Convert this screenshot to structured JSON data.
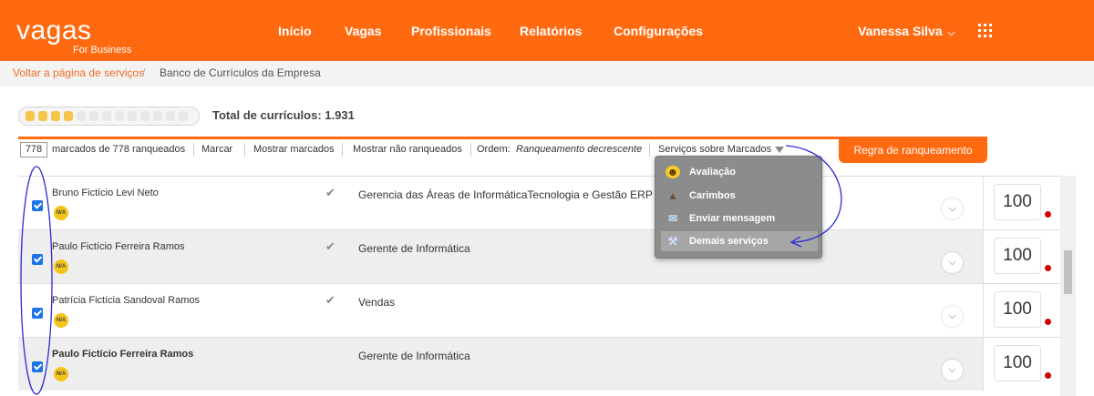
{
  "header": {
    "logo_word": "vagas",
    "logo_sub": "For Business",
    "nav": [
      "Início",
      "Vagas",
      "Profissionais",
      "Relatórios",
      "Configurações"
    ],
    "user_name": "Vanessa Silva",
    "apps_icon": "grid-icon"
  },
  "breadcrumb": {
    "back_link": "Voltar a página de serviços",
    "separator": "/",
    "current": "Banco de Currículos da Empresa"
  },
  "summary": {
    "total_label": "Total de currículos: 1.931"
  },
  "toolbar": {
    "marked_count": "778",
    "marked_text": "marcados de 778 ranqueados",
    "mark": "Marcar",
    "show_marked": "Mostrar marcados",
    "show_unranked": "Mostrar não ranqueados",
    "order_label": "Ordem:",
    "order_value": "Ranqueamento decrescente",
    "services_menu": "Serviços sobre Marcados",
    "ranking_rule_button": "Regra de ranqueamento"
  },
  "dropdown": {
    "items": [
      {
        "label": "Avaliação",
        "icon": "smiley-icon"
      },
      {
        "label": "Carimbos",
        "icon": "stamp-icon"
      },
      {
        "label": "Enviar mensagem",
        "icon": "envelope-icon"
      },
      {
        "label": "Demais serviços",
        "icon": "wrench-icon"
      }
    ],
    "highlighted_index": 3
  },
  "rows": [
    {
      "name": "Bruno Fictício Levi Neto",
      "badge": "N/A",
      "role": "Gerencia das Áreas de InformáticaTecnologia e Gestão ERP",
      "score": "100",
      "checked": true,
      "viewed": true
    },
    {
      "name": "Paulo Fictício Ferreira Ramos",
      "badge": "N/A",
      "role": "Gerente de Informática",
      "score": "100",
      "checked": true,
      "viewed": true
    },
    {
      "name": "Patrícia Fictícia Sandoval Ramos",
      "badge": "N/A",
      "role": "Vendas",
      "score": "100",
      "checked": true,
      "viewed": true
    },
    {
      "name": "Paulo Fictício Ferreira Ramos",
      "badge": "N/A",
      "role": "Gerente de Informática",
      "score": "100",
      "checked": true,
      "viewed": false
    }
  ],
  "colors": {
    "brand_orange": "#ff6a10",
    "link_orange": "#f06a24",
    "annotation_blue": "#2b2bd6",
    "status_red": "#d10000"
  }
}
